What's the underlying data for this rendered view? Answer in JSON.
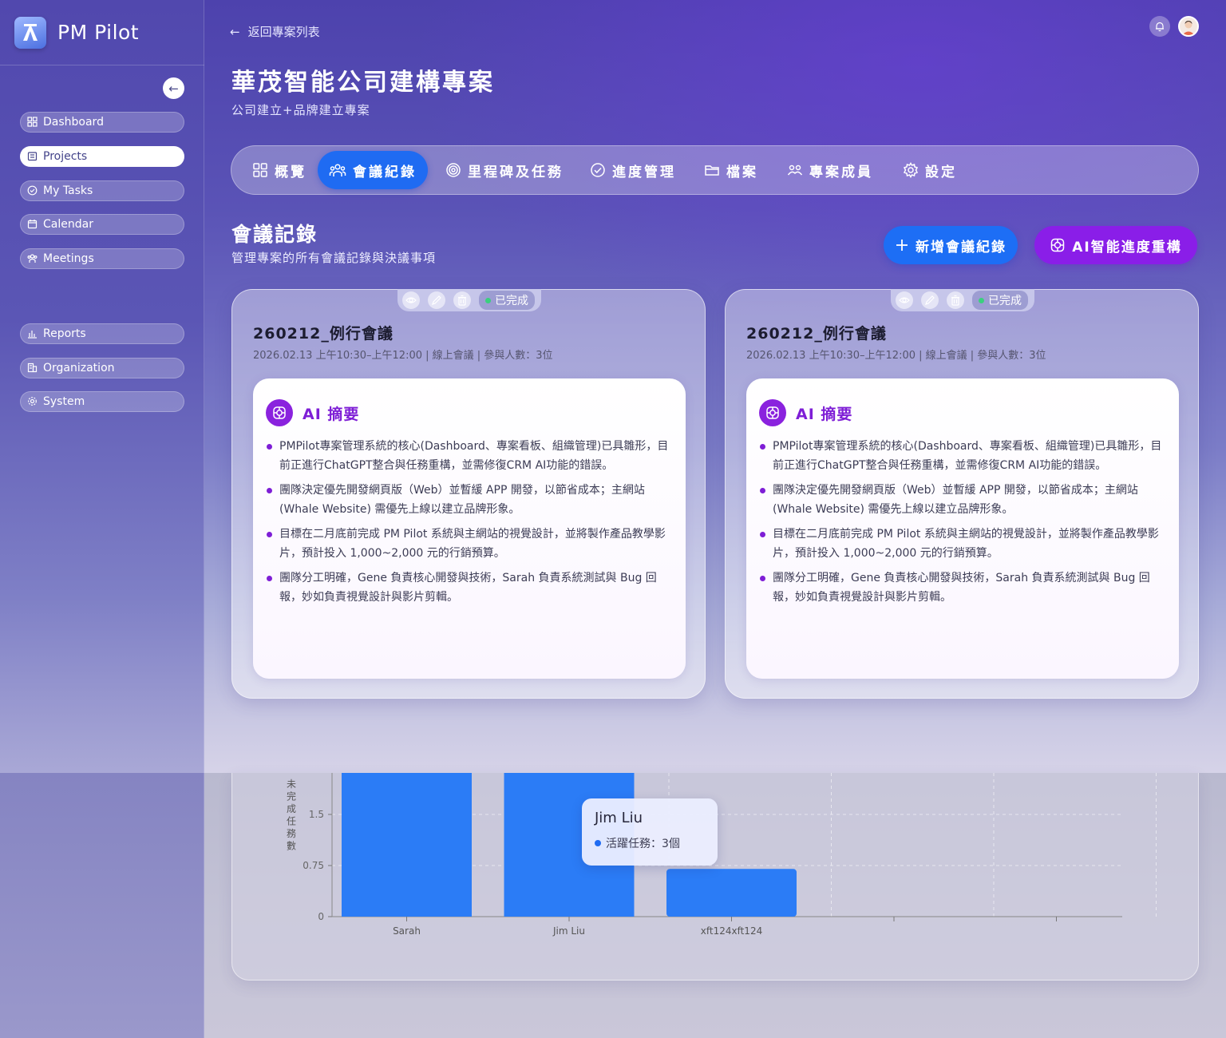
{
  "app": {
    "name": "PM Pilot"
  },
  "sidebar": {
    "items": [
      {
        "label": "Dashboard",
        "icon": "grid-icon"
      },
      {
        "label": "Projects",
        "icon": "folder-icon",
        "active": true
      },
      {
        "label": "My Tasks",
        "icon": "check-circle-icon"
      },
      {
        "label": "Calendar",
        "icon": "calendar-icon"
      },
      {
        "label": "Meetings",
        "icon": "team-icon"
      },
      {
        "label": "Reports",
        "icon": "bar-chart-icon"
      },
      {
        "label": "Organization",
        "icon": "building-icon"
      },
      {
        "label": "System",
        "icon": "gear-icon"
      }
    ]
  },
  "header": {
    "back_label": "返回專案列表",
    "title": "華茂智能公司建構專案",
    "subtitle": "公司建立+品牌建立專案"
  },
  "tabs": [
    {
      "label": "概覽",
      "icon": "grid-icon"
    },
    {
      "label": "會議紀錄",
      "icon": "team-icon",
      "active": true
    },
    {
      "label": "里程碑及任務",
      "icon": "target-icon"
    },
    {
      "label": "進度管理",
      "icon": "check-circle-icon"
    },
    {
      "label": "檔案",
      "icon": "folder-icon"
    },
    {
      "label": "專案成員",
      "icon": "members-icon"
    },
    {
      "label": "設定",
      "icon": "gear-icon"
    }
  ],
  "section": {
    "title": "會議記錄",
    "description": "管理專案的所有會議記錄與決議事項",
    "add_button": "新增會議紀錄",
    "ai_button": "AI智能進度重構"
  },
  "meetings": [
    {
      "title": "260212_例行會議",
      "meta": "2026.02.13 上午10:30–上午12:00 | 線上會議 | 參與人數：3位",
      "status": "已完成",
      "summary_title": "AI 摘要",
      "bullets": [
        "PMPilot專案管理系統的核心(Dashboard、專案看板、組織管理)已具雛形，目前正進行ChatGPT整合與任務重構，並需修復CRM AI功能的錯誤。",
        "團隊決定優先開發網頁版（Web）並暫緩 APP 開發，以節省成本；主網站(Whale Website) 需優先上線以建立品牌形象。",
        "目標在二月底前完成 PM Pilot 系統與主網站的視覺設計，並將製作產品教學影片，預計投入 1,000~2,000 元的行銷預算。",
        "團隊分工明確，Gene 負責核心開發與技術，Sarah 負責系統測試與 Bug 回報，妙如負責視覺設計與影片剪輯。"
      ]
    },
    {
      "title": "260212_例行會議",
      "meta": "2026.02.13 上午10:30–上午12:00 | 線上會議 | 參與人數：3位",
      "status": "已完成",
      "summary_title": "AI 摘要",
      "bullets": [
        "PMPilot專案管理系統的核心(Dashboard、專案看板、組織管理)已具雛形，目前正進行ChatGPT整合與任務重構，並需修復CRM AI功能的錯誤。",
        "團隊決定優先開發網頁版（Web）並暫緩 APP 開發，以節省成本；主網站(Whale Website) 需優先上線以建立品牌形象。",
        "目標在二月底前完成 PM Pilot 系統與主網站的視覺設計，並將製作產品教學影片，預計投入 1,000~2,000 元的行銷預算。",
        "團隊分工明確，Gene 負責核心開發與技術，Sarah 負責系統測試與 Bug 回報，妙如負責視覺設計與影片剪輯。"
      ]
    }
  ],
  "chart_data": {
    "type": "bar",
    "ylabel": "未完成任務數",
    "categories": [
      "Sarah",
      "Jim Liu",
      "xft124xft124"
    ],
    "values": [
      2.5,
      2.5,
      0.7
    ],
    "yticks": [
      "0",
      "0.75",
      "1.5"
    ],
    "ylim": [
      0,
      2.25
    ],
    "bar_color": "#2b7cf6",
    "grid": true,
    "tooltip": {
      "title": "Jim Liu",
      "label": "活躍任務：3個"
    }
  },
  "colors": {
    "accent": "#1f6bf2",
    "ai": "#8a1ee8",
    "success": "#3ad07e"
  }
}
